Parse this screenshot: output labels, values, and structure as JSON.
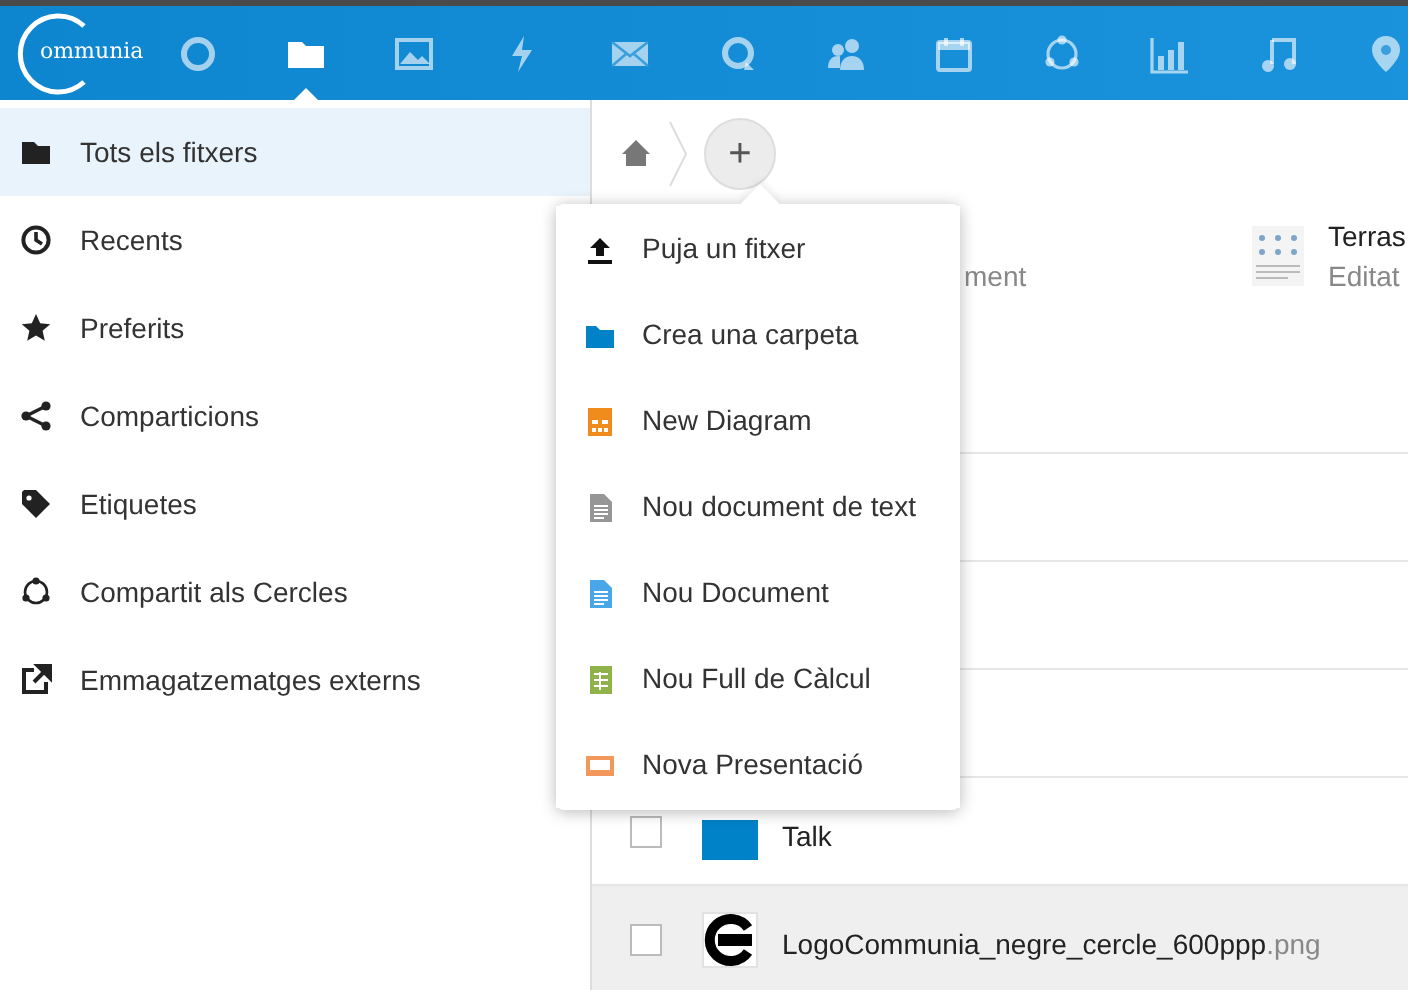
{
  "header": {
    "logo_text": "ommunia",
    "apps": [
      {
        "kind": "circle",
        "selected": false
      },
      {
        "kind": "folder",
        "selected": true
      },
      {
        "kind": "image",
        "selected": false
      },
      {
        "kind": "bolt",
        "selected": false
      },
      {
        "kind": "mail",
        "selected": false
      },
      {
        "kind": "talk",
        "selected": false
      },
      {
        "kind": "contacts",
        "selected": false
      },
      {
        "kind": "calendar",
        "selected": false
      },
      {
        "kind": "circles",
        "selected": false
      },
      {
        "kind": "chart",
        "selected": false
      },
      {
        "kind": "music",
        "selected": false
      },
      {
        "kind": "pin",
        "selected": false
      }
    ]
  },
  "sidebar": {
    "items": [
      {
        "kind": "folder",
        "label": "Tots els fitxers",
        "selected": true
      },
      {
        "kind": "clock",
        "label": "Recents",
        "selected": false
      },
      {
        "kind": "star",
        "label": "Preferits",
        "selected": false
      },
      {
        "kind": "share",
        "label": "Comparticions",
        "selected": false
      },
      {
        "kind": "tag",
        "label": "Etiquetes",
        "selected": false
      },
      {
        "kind": "circles",
        "label": "Compartit als Cercles",
        "selected": false
      },
      {
        "kind": "external",
        "label": "Emmagatzematges externs",
        "selected": false
      }
    ]
  },
  "add_button": {
    "label": "+"
  },
  "recommendations": [
    {
      "subtitle": "ment"
    },
    {
      "title": "Terras",
      "subtitle": "Editat"
    }
  ],
  "new_menu": {
    "items": [
      {
        "kind": "upload",
        "label": "Puja un fitxer"
      },
      {
        "kind": "folder",
        "label": "Crea una carpeta"
      },
      {
        "kind": "diagram",
        "label": "New Diagram"
      },
      {
        "kind": "text",
        "label": "Nou document de text"
      },
      {
        "kind": "document",
        "label": "Nou Document"
      },
      {
        "kind": "spreadsheet",
        "label": "Nou Full de Càlcul"
      },
      {
        "kind": "presentation",
        "label": "Nova Presentació"
      }
    ]
  },
  "files": [
    {
      "kind": "hidden"
    },
    {
      "kind": "hidden"
    },
    {
      "kind": "hidden"
    },
    {
      "kind": "folder",
      "name": "Talk",
      "checked": false,
      "highlighted": false
    },
    {
      "kind": "image",
      "name": "LogoCommunia_negre_cercle_600ppp",
      "extension": ".png",
      "checked": false,
      "highlighted": true
    }
  ]
}
